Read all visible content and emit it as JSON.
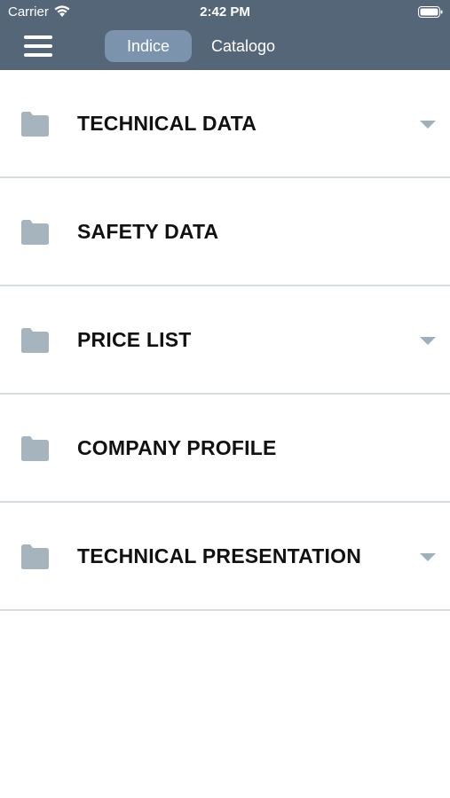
{
  "status_bar": {
    "carrier": "Carrier",
    "time": "2:42 PM",
    "wifi_icon": "wifi-icon",
    "battery_icon": "battery-icon"
  },
  "nav": {
    "menu_icon": "hamburger-menu-icon",
    "tabs": [
      {
        "label": "Indice",
        "selected": true
      },
      {
        "label": "Catalogo",
        "selected": false
      }
    ]
  },
  "list": {
    "items": [
      {
        "label": "TECHNICAL DATA",
        "icon": "folder-icon",
        "expandable": true
      },
      {
        "label": "SAFETY DATA",
        "icon": "folder-icon",
        "expandable": false
      },
      {
        "label": "PRICE LIST",
        "icon": "folder-icon",
        "expandable": true
      },
      {
        "label": "COMPANY PROFILE",
        "icon": "folder-icon",
        "expandable": false
      },
      {
        "label": "TECHNICAL PRESENTATION",
        "icon": "folder-icon",
        "expandable": true
      }
    ]
  },
  "colors": {
    "header_bg": "#566679",
    "tab_active_bg": "#7b93ad",
    "folder": "#a6b4bd",
    "chevron": "#9fb0bd",
    "divider": "#d6dde3"
  }
}
